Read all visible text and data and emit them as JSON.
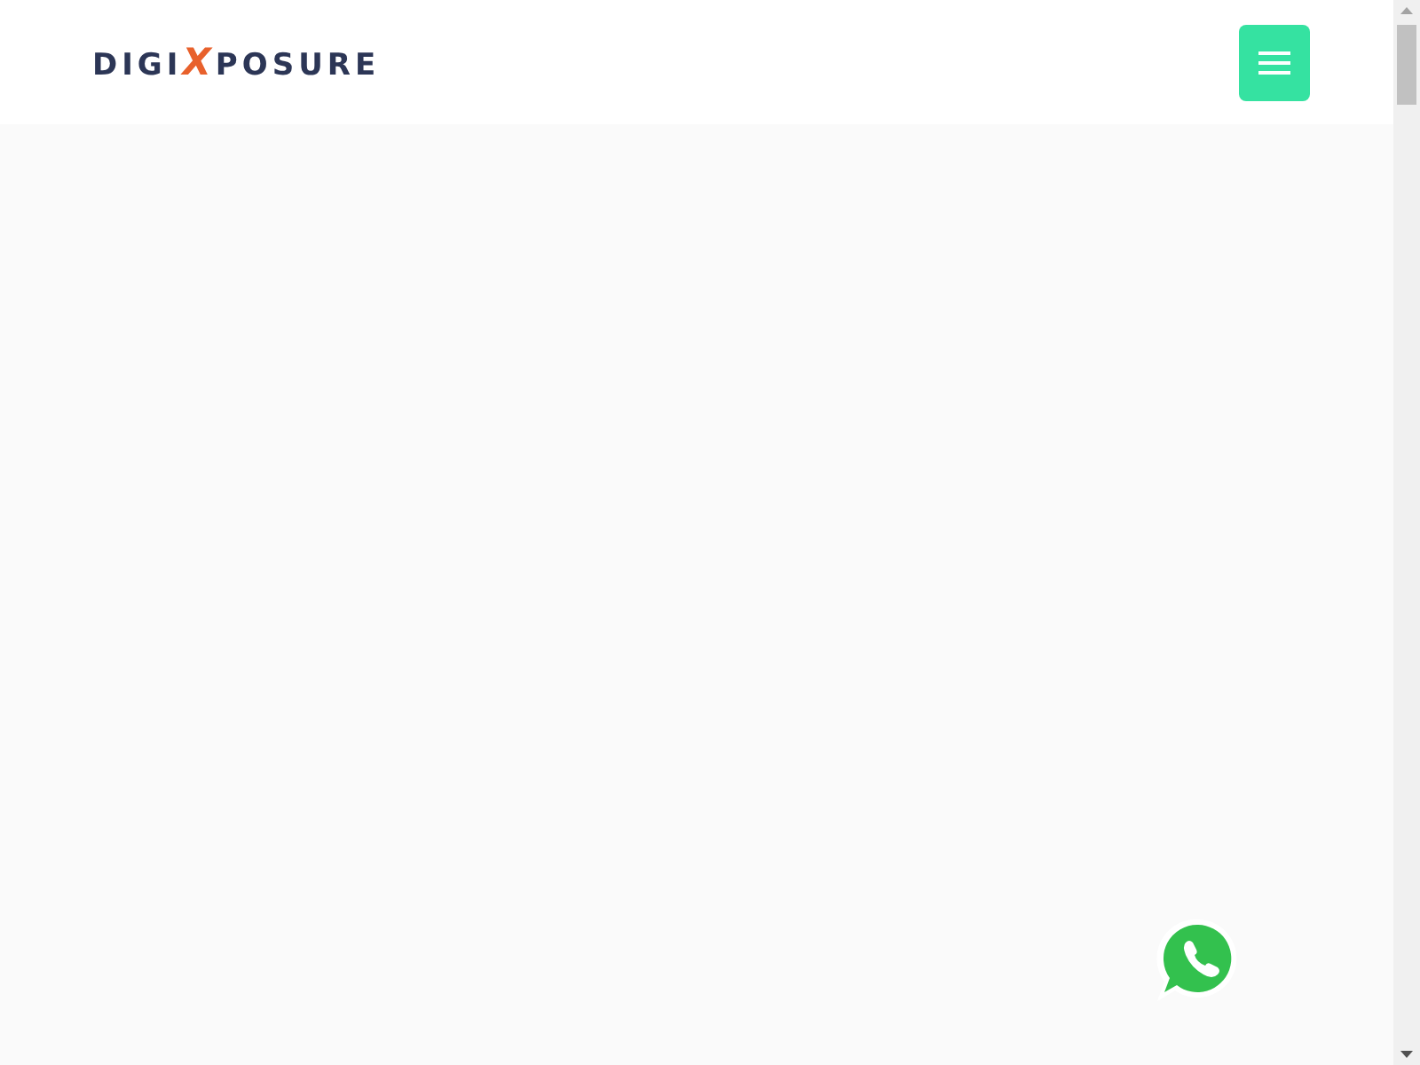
{
  "header": {
    "logo": {
      "parts": [
        "DIGI",
        "X",
        "POSURE"
      ]
    }
  }
}
